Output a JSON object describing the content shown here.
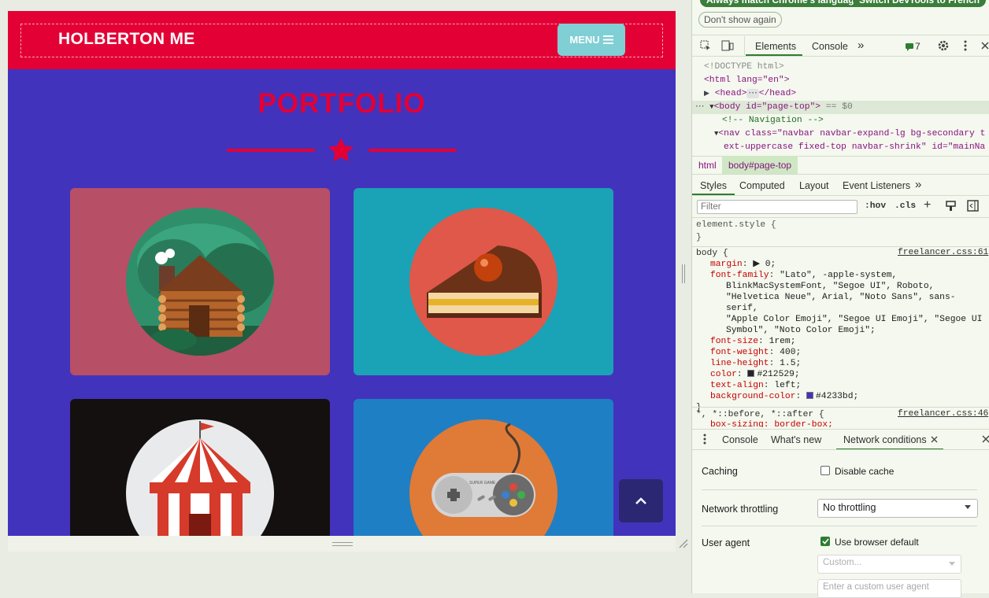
{
  "preview": {
    "brand": "HOLBERTON ME",
    "menu_label": "MENU",
    "section_title": "PORTFOLIO",
    "colors": {
      "bg": "#4233bd",
      "navbar": "#e30035",
      "menu": "#7fcfd4",
      "accent": "#e30035"
    },
    "cards": [
      {
        "name": "cabin",
        "icon": "cabin-icon",
        "bg": "#b74f67"
      },
      {
        "name": "cake",
        "icon": "cake-icon",
        "bg": "#1aa2b6"
      },
      {
        "name": "circus",
        "icon": "circus-tent-icon",
        "bg": "#141010"
      },
      {
        "name": "game",
        "icon": "game-controller-icon",
        "bg": "#1f7fc4"
      }
    ],
    "controller_brand": "SUPER GAME"
  },
  "devtools": {
    "top_buttons": [
      "Always match Chrome's language",
      "Switch DevTools to French",
      "Don't show again"
    ],
    "tabs": [
      "Elements",
      "Console"
    ],
    "issues_count": "7",
    "dom": {
      "doctype": "<!DOCTYPE html>",
      "html_open": "<html lang=\"en\">",
      "head": "<head>",
      "head_close": "</head>",
      "body_open": "<body id=\"page-top\">",
      "body_suffix": "== $0",
      "comment": "<!-- Navigation -->",
      "nav_line1": "<nav class=\"navbar navbar-expand-lg bg-secondary t",
      "nav_line2": "ext-uppercase fixed-top navbar-shrink\" id=\"mainNa"
    },
    "breadcrumb": [
      "html",
      "body#page-top"
    ],
    "style_tabs": [
      "Styles",
      "Computed",
      "Layout",
      "Event Listeners"
    ],
    "filter_placeholder": "Filter",
    "hov": ":hov",
    "cls": ".cls",
    "element_style": "element.style {",
    "body_rule": {
      "selector": "body {",
      "source": "freelancer.css:61",
      "decls": [
        {
          "p": "margin",
          "v": "▶ 0;"
        },
        {
          "p": "font-family",
          "v": "\"Lato\", -apple-system,"
        },
        {
          "p": "",
          "v": "BlinkMacSystemFont, \"Segoe UI\", Roboto,"
        },
        {
          "p": "",
          "v": "\"Helvetica Neue\", Arial, \"Noto Sans\", sans-serif,"
        },
        {
          "p": "",
          "v": "\"Apple Color Emoji\", \"Segoe UI Emoji\", \"Segoe UI"
        },
        {
          "p": "",
          "v": "Symbol\", \"Noto Color Emoji\";"
        },
        {
          "p": "font-size",
          "v": "1rem;"
        },
        {
          "p": "font-weight",
          "v": "400;"
        },
        {
          "p": "line-height",
          "v": "1.5;"
        },
        {
          "p": "color",
          "v": "#212529;",
          "swatch": "#212529"
        },
        {
          "p": "text-align",
          "v": "left;"
        },
        {
          "p": "background-color",
          "v": "#4233bd;",
          "swatch": "#4233bd"
        }
      ]
    },
    "universal_rule": {
      "selector": "*, *::before, *::after {",
      "source": "freelancer.css:46",
      "first": "box-sizing: border-box;"
    },
    "drawer_tabs": [
      "Console",
      "What's new",
      "Network conditions"
    ],
    "network": {
      "caching_label": "Caching",
      "disable_cache": "Disable cache",
      "throttling_label": "Network throttling",
      "throttling_value": "No throttling",
      "ua_label": "User agent",
      "ua_default": "Use browser default",
      "ua_custom": "Custom...",
      "ua_input_placeholder": "Enter a custom user agent"
    }
  }
}
